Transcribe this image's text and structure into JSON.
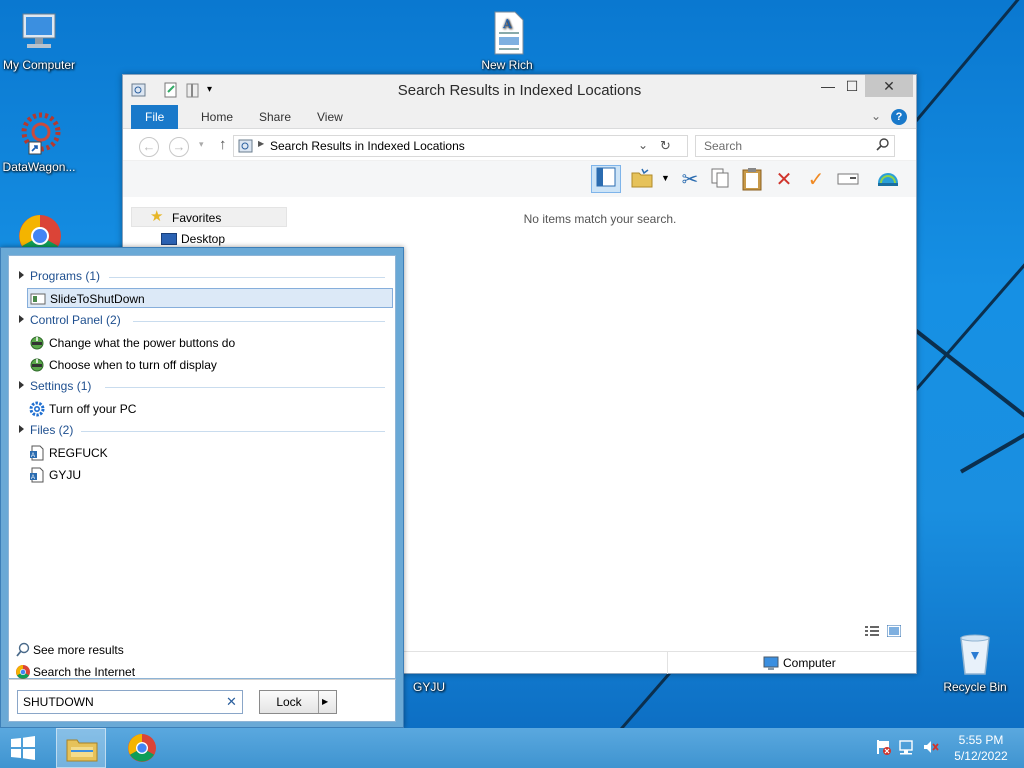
{
  "desktop": {
    "icons": [
      {
        "label": "My Computer"
      },
      {
        "label": "DataWagon..."
      },
      {
        "label": "New Rich"
      },
      {
        "label": "GYJU"
      },
      {
        "label": "Recycle Bin"
      }
    ]
  },
  "explorer": {
    "title": "Search Results in Indexed Locations",
    "tabs": [
      {
        "label": "File"
      },
      {
        "label": "Home"
      },
      {
        "label": "Share"
      },
      {
        "label": "View"
      }
    ],
    "address": "Search Results in Indexed Locations",
    "search_placeholder": "Search",
    "empty_message": "No items match your search.",
    "nav": {
      "favorites": "Favorites",
      "desktop": "Desktop"
    },
    "status_location": "Computer"
  },
  "start_search": {
    "groups": {
      "programs": "Programs (1)",
      "control_panel": "Control Panel (2)",
      "settings": "Settings (1)",
      "files": "Files (2)"
    },
    "results": {
      "slide_to_shutdown": "SlideToShutDown",
      "power_buttons": "Change what the power buttons do",
      "turn_off_display": "Choose when to turn off display",
      "turn_off_pc": "Turn off your PC",
      "regfuck": "REGFUCK",
      "gyju": "GYJU"
    },
    "see_more": "See more results",
    "search_internet": "Search the Internet",
    "query": "SHUTDOWN",
    "power_button": "Lock"
  },
  "taskbar": {
    "time": "5:55 PM",
    "date": "5/12/2022"
  },
  "colors": {
    "accent": "#1979ca",
    "desktop_bg": "#1a8fe0",
    "group_text": "#1e4f8f"
  }
}
